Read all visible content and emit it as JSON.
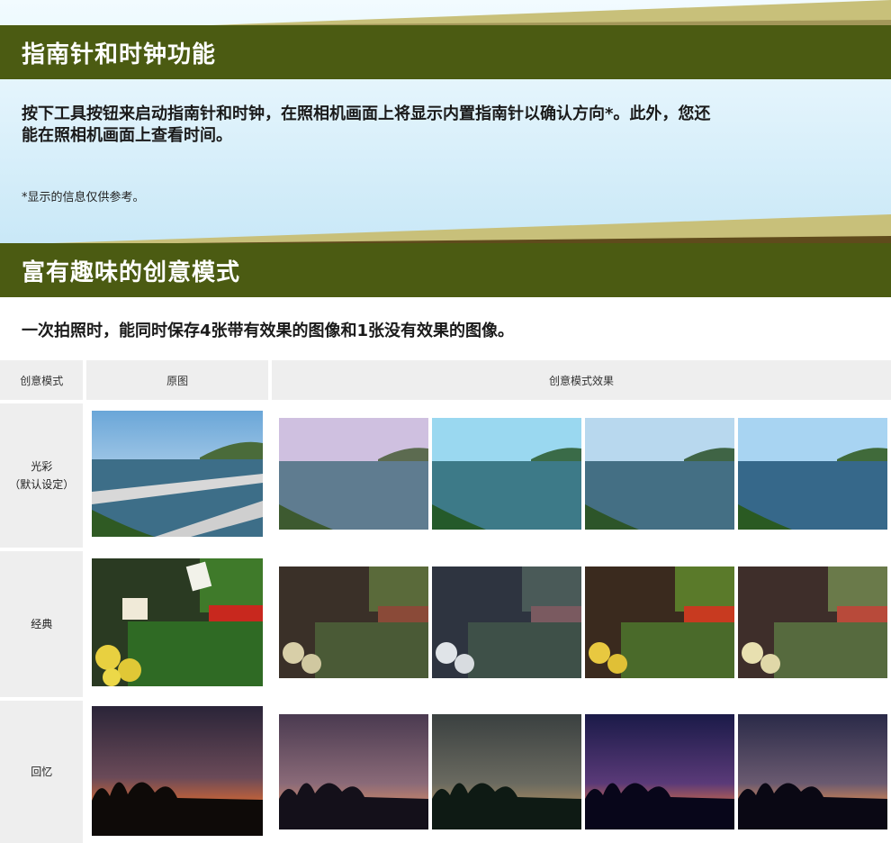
{
  "section1": {
    "title": "指南针和时钟功能",
    "desc_line1": "按下工具按钮来启动指南针和时钟，在照相机画面上将显示内置指南针以确认方向*。此外，您还",
    "desc_line2": "能在照相机画面上查看时间。",
    "note": "*显示的信息仅供参考。"
  },
  "section2": {
    "title": "富有趣味的创意模式",
    "desc": "一次拍照时，能同时保存4张带有效果的图像和1张没有效果的图像。"
  },
  "table": {
    "headers": [
      "创意模式",
      "原图",
      "创意模式效果"
    ],
    "rows": [
      {
        "label_line1": "光彩",
        "label_line2": "（默认设定）",
        "subject": "harbor"
      },
      {
        "label_line1": "经典",
        "label_line2": "",
        "subject": "vegetables"
      },
      {
        "label_line1": "回忆",
        "label_line2": "",
        "subject": "sunset"
      }
    ]
  },
  "colors": {
    "heading_bg": "#4b5b12",
    "stripe_light": "#c8c07a",
    "stripe_dark": "#5f4b1c",
    "sky_top": "#f2fbff",
    "sky_bottom": "#c9e8f7"
  }
}
